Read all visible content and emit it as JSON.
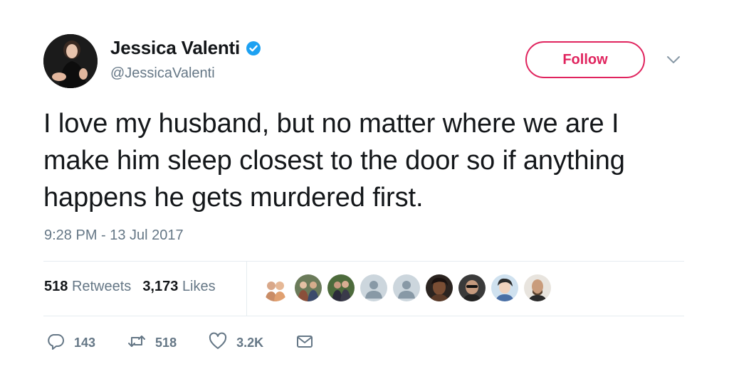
{
  "user": {
    "display_name": "Jessica Valenti",
    "handle": "@JessicaValenti",
    "verified": true
  },
  "follow_label": "Follow",
  "tweet_text": "I love my husband, but no matter where we are I make him sleep closest to the door so if anything happens he gets murdered first.",
  "timestamp": "9:28 PM - 13 Jul 2017",
  "stats": {
    "retweets_count": "518",
    "retweets_label": "Retweets",
    "likes_count": "3,173",
    "likes_label": "Likes"
  },
  "liker_avatars": [
    "avatar-1",
    "avatar-2",
    "avatar-3",
    "avatar-4",
    "avatar-5",
    "avatar-6",
    "avatar-7",
    "avatar-8",
    "avatar-9"
  ],
  "actions": {
    "reply_count": "143",
    "retweet_count": "518",
    "like_count": "3.2K"
  },
  "colors": {
    "follow_accent": "#e0245e",
    "secondary_text": "#657786",
    "verified_blue": "#1da1f2",
    "primary_text": "#14171a"
  },
  "icons": {
    "verified": "verified-badge-icon",
    "caret": "chevron-down-icon",
    "reply": "reply-icon",
    "retweet": "retweet-icon",
    "like": "heart-icon",
    "dm": "envelope-icon"
  }
}
